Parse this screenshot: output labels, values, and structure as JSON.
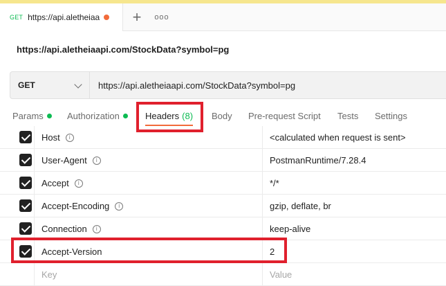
{
  "tab": {
    "method": "GET",
    "title": "https://api.aletheiaapi.com/",
    "more_label": "ooo"
  },
  "request": {
    "name": "https://api.aletheiaapi.com/StockData?symbol=pg",
    "method": "GET",
    "url": "https://api.aletheiaapi.com/StockData?symbol=pg"
  },
  "subtabs": {
    "params": "Params",
    "authorization": "Authorization",
    "headers": "Headers",
    "headers_count": "(8)",
    "body": "Body",
    "prerequest": "Pre-request Script",
    "tests": "Tests",
    "settings": "Settings"
  },
  "headers": [
    {
      "key": "Host",
      "value": "<calculated when request is sent>",
      "checked": true
    },
    {
      "key": "User-Agent",
      "value": "PostmanRuntime/7.28.4",
      "checked": true
    },
    {
      "key": "Accept",
      "value": "*/*",
      "checked": true
    },
    {
      "key": "Accept-Encoding",
      "value": "gzip, deflate, br",
      "checked": true
    },
    {
      "key": "Connection",
      "value": "keep-alive",
      "checked": true
    },
    {
      "key": "Accept-Version",
      "value": "2",
      "checked": true
    }
  ],
  "new_row": {
    "key_placeholder": "Key",
    "value_placeholder": "Value"
  },
  "colors": {
    "accent": "#f26b3a",
    "green": "#0cbb52",
    "highlight": "#e0202d"
  }
}
